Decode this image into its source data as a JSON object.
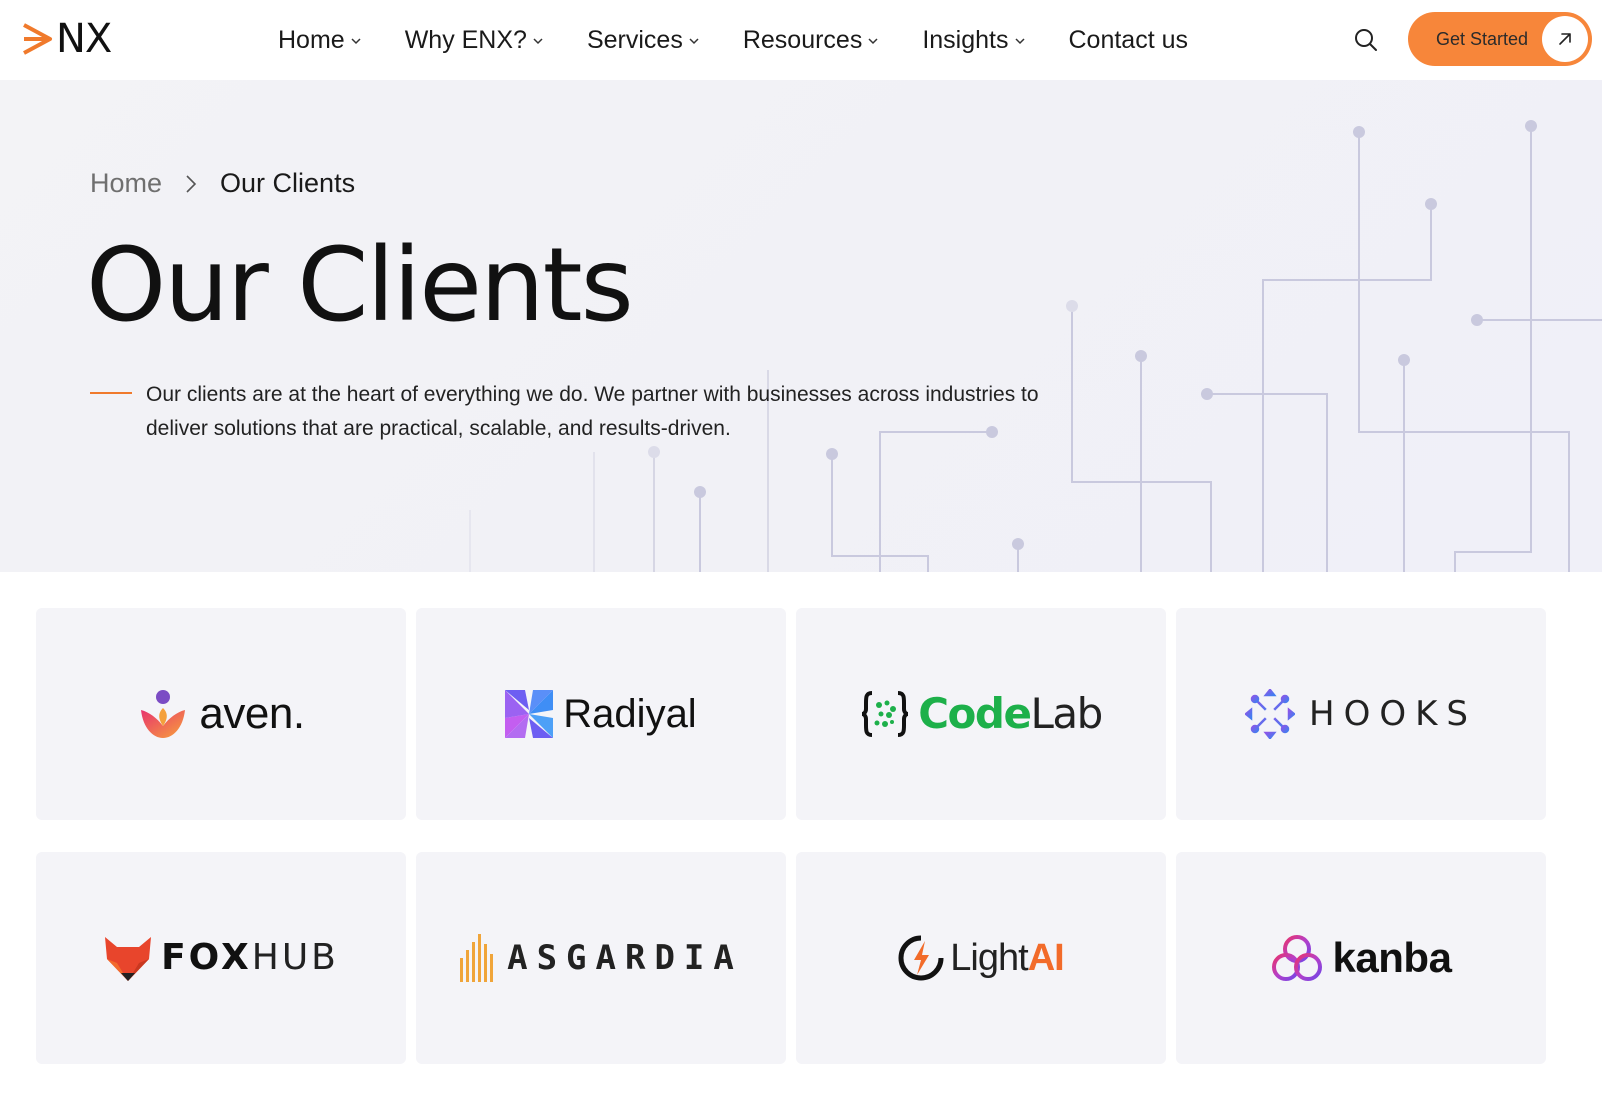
{
  "header": {
    "logo_text": "NX",
    "nav": [
      {
        "label": "Home",
        "has_dropdown": true
      },
      {
        "label": "Why ENX?",
        "has_dropdown": true
      },
      {
        "label": "Services",
        "has_dropdown": true
      },
      {
        "label": "Resources",
        "has_dropdown": true
      },
      {
        "label": "Insights",
        "has_dropdown": true
      },
      {
        "label": "Contact us",
        "has_dropdown": false
      }
    ],
    "search_icon": "search-icon",
    "cta_label": "Get Started",
    "cta_icon": "arrow-up-right-icon"
  },
  "hero": {
    "breadcrumb": {
      "home": "Home",
      "current": "Our Clients"
    },
    "title": "Our Clients",
    "description": "Our clients are at the heart of everything we do. We partner with businesses across industries to deliver solutions that are practical, scalable, and results-driven."
  },
  "clients": [
    {
      "name": "aven.",
      "logo": "aven-logo"
    },
    {
      "name": "Radiyal",
      "logo": "radiyal-logo"
    },
    {
      "name_parts": [
        "Code",
        "Lab"
      ],
      "logo": "codelab-logo"
    },
    {
      "name": "HOOKS",
      "logo": "hooks-logo"
    },
    {
      "name_parts": [
        "FOX",
        "HUB"
      ],
      "logo": "foxhub-logo"
    },
    {
      "name": "ASGARDIA",
      "logo": "asgardia-logo"
    },
    {
      "name_parts": [
        "Light",
        "AI"
      ],
      "logo": "lightai-logo"
    },
    {
      "name": "kanba",
      "logo": "kanba-logo"
    }
  ],
  "colors": {
    "accent": "#f7863a",
    "hero_background": "#f2f2f7",
    "card_background": "#f4f4f8",
    "circuit_lines": "#c9c9de",
    "codelab_green": "#1db04a",
    "lightai_orange": "#f26b2a"
  }
}
